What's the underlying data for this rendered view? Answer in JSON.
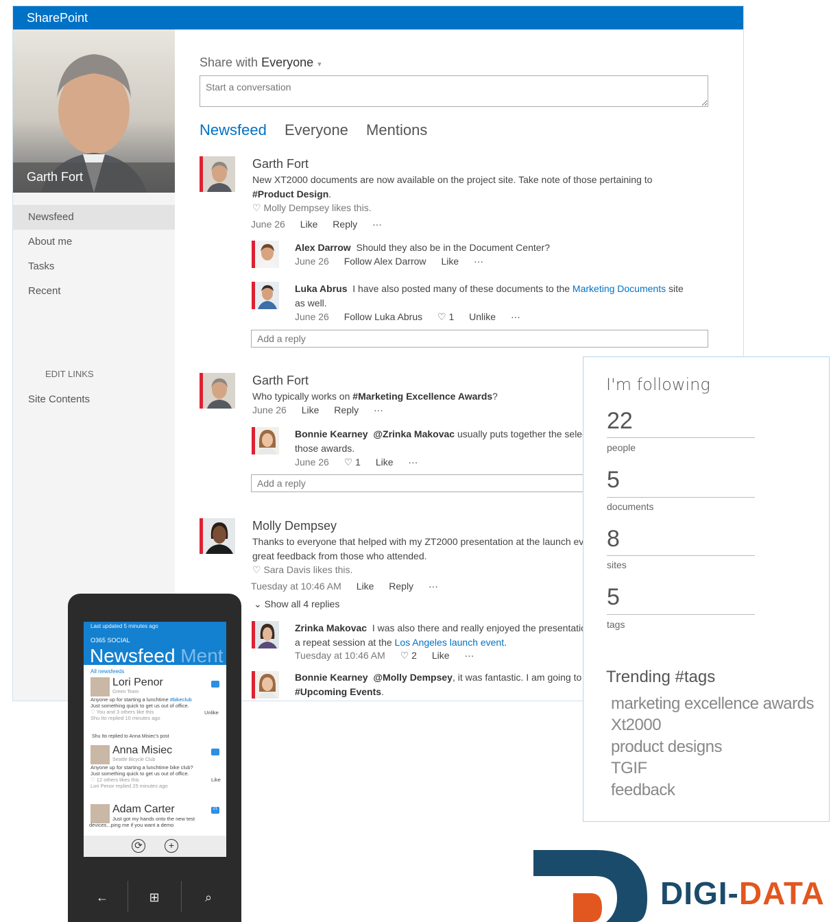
{
  "app": {
    "brand": "SharePoint"
  },
  "profile": {
    "name": "Garth Fort"
  },
  "nav": {
    "items": [
      "Newsfeed",
      "About me",
      "Tasks",
      "Recent"
    ],
    "edit_links": "EDIT LINKS",
    "site_contents": "Site Contents"
  },
  "share": {
    "prefix": "Share with",
    "audience": "Everyone",
    "caret": "▾",
    "placeholder": "Start a conversation"
  },
  "tabs": [
    "Newsfeed",
    "Everyone",
    "Mentions"
  ],
  "posts": [
    {
      "author": "Garth Fort",
      "text": "New XT2000 documents are now available on the project site. Take note of those pertaining to",
      "tag": "#Product Design",
      "tag_suffix": ".",
      "likes": "♡ Molly Dempsey likes this.",
      "date": "June 26",
      "actions": [
        "Like",
        "Reply",
        "···"
      ],
      "replies": [
        {
          "author": "Alex Darrow",
          "text": "Should they also be in the Document Center?",
          "date": "June 26",
          "actions": [
            "Follow Alex Darrow",
            "Like",
            "···"
          ]
        },
        {
          "author": "Luka Abrus",
          "text_before": "I have also posted many of these documents to the",
          "link": "Marketing Documents",
          "text_after": "site",
          "text_line2": "as well.",
          "date": "June 26",
          "actions": [
            "Follow Luka Abrus",
            "♡ 1",
            "Unlike",
            "···"
          ]
        }
      ],
      "reply_placeholder": "Add a reply"
    },
    {
      "author": "Garth Fort",
      "text": "Who typically works on",
      "tag": "#Marketing Excellence Awards",
      "tag_suffix": "?",
      "date": "June 26",
      "actions": [
        "Like",
        "Reply",
        "···"
      ],
      "replies": [
        {
          "author": "Bonnie Kearney",
          "mention": "@Zrinka Makovac",
          "text": "usually puts together the selec",
          "text_line2": "those awards.",
          "date": "June 26",
          "actions": [
            "♡ 1",
            "Like",
            "···"
          ]
        }
      ],
      "reply_placeholder": "Add a reply"
    },
    {
      "author": "Molly Dempsey",
      "text": "Thanks to everyone that helped with my ZT2000 presentation at the launch ev",
      "text_line2": "great feedback from those who attended.",
      "likes": "♡ Sara Davis likes this.",
      "date": "Tuesday at 10:46 AM",
      "actions": [
        "Like",
        "Reply",
        "···"
      ],
      "show_replies": "⌄ Show all 4 replies",
      "replies": [
        {
          "author": "Zrinka Makovac",
          "text": "I was also there and really enjoyed the presentatio",
          "text_line2_before": "a repeat session at the",
          "link": "Los Angeles launch event",
          "text_line2_after": ".",
          "date": "Tuesday at 10:46 AM",
          "actions": [
            "♡ 2",
            "Like",
            "···"
          ]
        },
        {
          "author": "Bonnie Kearney",
          "mention": "@Molly Dempsey",
          "text": ", it was fantastic. I am going to",
          "text_line2": "#Upcoming Events",
          "text_line2_suffix": "."
        }
      ]
    }
  ],
  "following": {
    "title": "I'm following",
    "stats": [
      {
        "value": "22",
        "label": "people"
      },
      {
        "value": "5",
        "label": "documents"
      },
      {
        "value": "8",
        "label": "sites"
      },
      {
        "value": "5",
        "label": "tags"
      }
    ],
    "trending_title": "Trending #tags",
    "tags": [
      "marketing excellence awards",
      "Xt2000",
      "product designs",
      "TGIF",
      "feedback"
    ]
  },
  "phone": {
    "updated": "Last updated 5 minutes ago",
    "app": "O365 SOCIAL",
    "title": "Newsfeed",
    "title_next": "Ment",
    "all_newsfeeds": "All newsfeeds",
    "items": [
      {
        "name": "Lori Penor",
        "sub": "Green Team",
        "line1_before": "Anyone up for starting a lunchtime",
        "line1_link": "#bikeclub",
        "line2": "Just something quick to get us out of office.",
        "line3": "♡ You and 3 others like this",
        "line4": "Shu Ito replied 10 minutes ago",
        "right": "Unlike"
      },
      {
        "context": "Shu Ito replied to Anna Misiec's post",
        "name": "Anna Misiec",
        "sub": "Seattle Bicycle Club",
        "line1": "Anyone up for starting a lunchtime bike club?",
        "line2": "Just something quick to get us out of office.",
        "line3": "♡ 12 others likes this",
        "line4": "Lori Penor replied 25 minutes ago",
        "right": "Like"
      },
      {
        "name": "Adam Carter",
        "line1": "Just got my hands onto the new test",
        "line2": "devices...ping me if you want a demo",
        "badge": "21"
      }
    ],
    "keys": {
      "back": "←",
      "start": "⊞",
      "search": "⌕"
    },
    "footer": {
      "sync": "⟳",
      "add": "+"
    }
  },
  "logo": {
    "text_dark": "DIGI-",
    "text_orange": "DATA"
  },
  "colors": {
    "accent": "#0072c6",
    "flag": "#dd2222",
    "logo_orange": "#e2571f",
    "logo_dark": "#1b4b6b"
  }
}
